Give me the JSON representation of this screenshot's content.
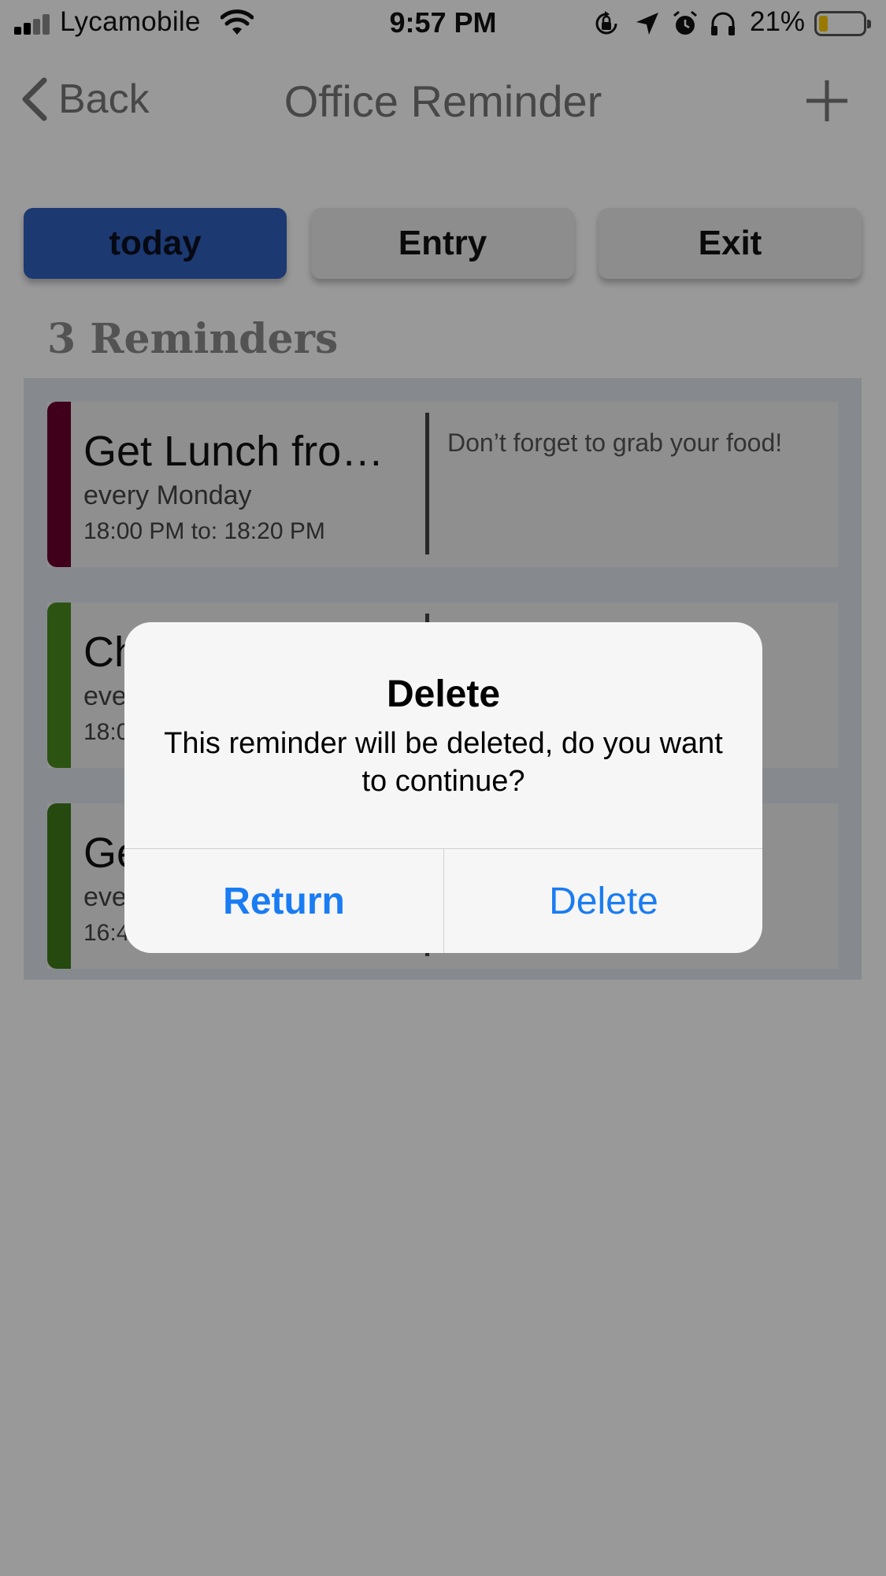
{
  "status_bar": {
    "carrier": "Lycamobile",
    "time": "9:57 PM",
    "battery_percent": "21%",
    "battery_level": 0.21,
    "icons": [
      "signal-icon",
      "wifi-icon",
      "rotation-lock-icon",
      "location-arrow-icon",
      "alarm-icon",
      "headphones-icon",
      "battery-icon"
    ]
  },
  "nav": {
    "back_label": "Back",
    "title": "Office Reminder",
    "add_icon": "plus-icon"
  },
  "tabs": [
    {
      "label": "today",
      "active": true
    },
    {
      "label": "Entry",
      "active": false
    },
    {
      "label": "Exit",
      "active": false
    }
  ],
  "reminders_count_label": "3 Reminders",
  "reminders": [
    {
      "title": "Get Lunch from…",
      "repeat": "every  Monday",
      "time": "18:00 PM to: 18:20 PM",
      "note": "Don’t  forget to grab your food!",
      "color": "#6b0030"
    },
    {
      "title": "Ch",
      "repeat": "eve",
      "time": "18:0",
      "note": "",
      "color": "#4b8a1e"
    },
    {
      "title": "Ge",
      "repeat": "eve",
      "time": "16:4",
      "note": "",
      "color": "#3f7a1a"
    }
  ],
  "alert": {
    "title": "Delete",
    "message": "This reminder will be deleted, do you want to continue?",
    "buttons": {
      "return": "Return",
      "delete": "Delete"
    }
  },
  "colors": {
    "accent_blue": "#1a7cf2",
    "active_tab": "#2f5fbd"
  }
}
